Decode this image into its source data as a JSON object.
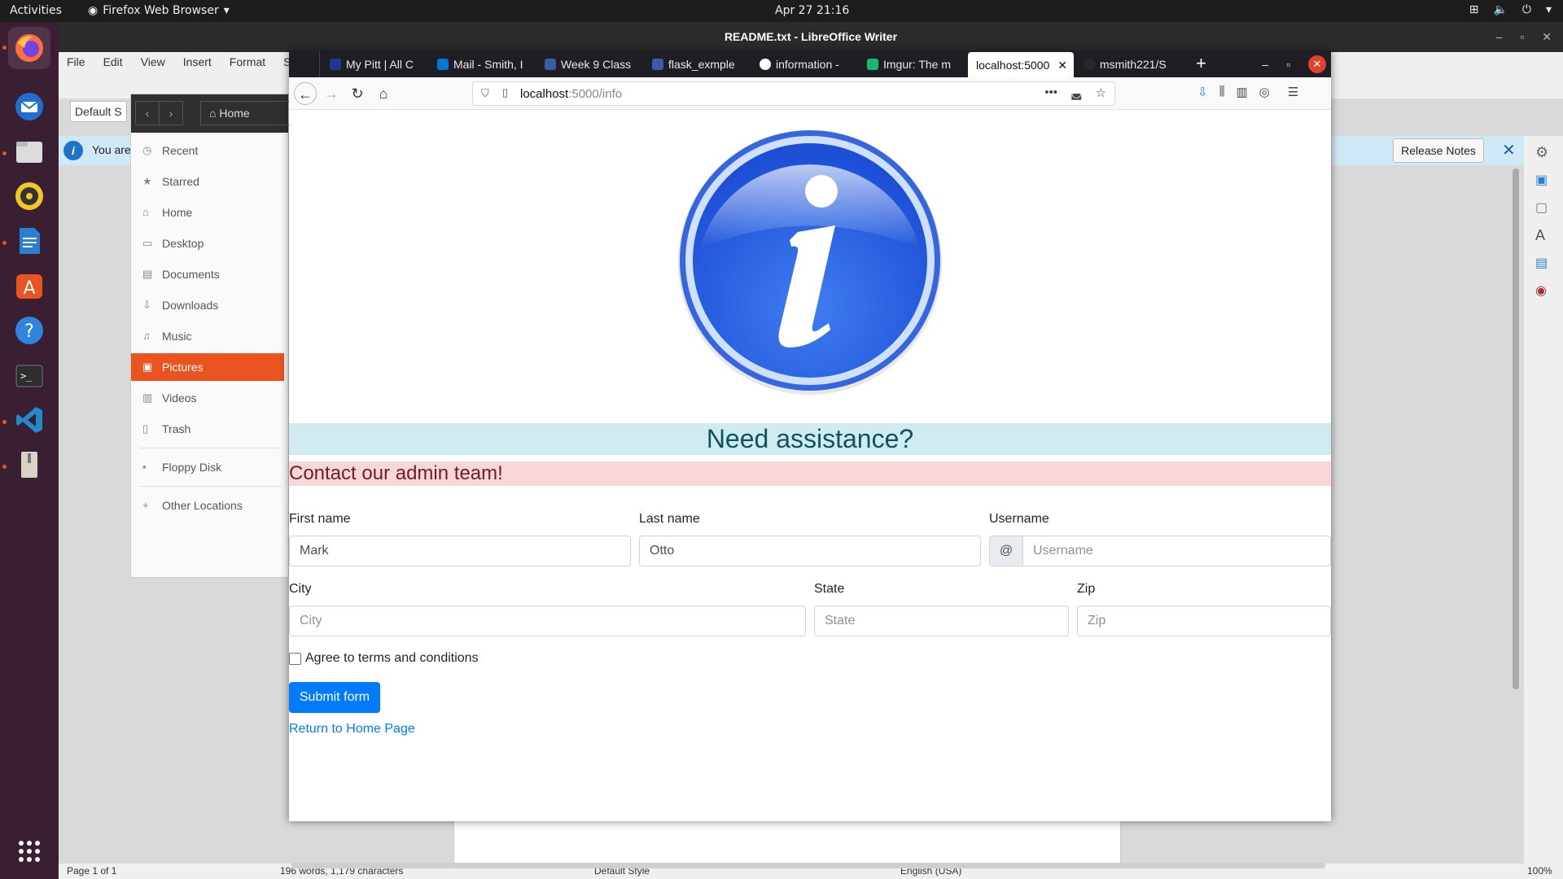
{
  "topbar": {
    "activities": "Activities",
    "app_name": "Firefox Web Browser",
    "clock": "Apr 27  21:16"
  },
  "writer": {
    "title": "README.txt - LibreOffice Writer",
    "menu": [
      "File",
      "Edit",
      "View",
      "Insert",
      "Format",
      "Sty"
    ],
    "para_style": "Default S",
    "info_msg": "You are",
    "release_notes": "Release Notes",
    "status": {
      "page": "Page 1 of 1",
      "words": "196 words, 1,179 characters",
      "style": "Default Style",
      "lang": "English (USA)",
      "zoom": "100%"
    }
  },
  "files": {
    "breadcrumb": "Home",
    "sidebar": [
      {
        "label": "Recent",
        "icon": "clock-icon"
      },
      {
        "label": "Starred",
        "icon": "star-icon"
      },
      {
        "label": "Home",
        "icon": "home-icon"
      },
      {
        "label": "Desktop",
        "icon": "desktop-icon"
      },
      {
        "label": "Documents",
        "icon": "document-icon"
      },
      {
        "label": "Downloads",
        "icon": "download-icon"
      },
      {
        "label": "Music",
        "icon": "music-icon"
      },
      {
        "label": "Pictures",
        "icon": "picture-icon",
        "active": true
      },
      {
        "label": "Videos",
        "icon": "video-icon"
      },
      {
        "label": "Trash",
        "icon": "trash-icon"
      },
      {
        "label": "Floppy Disk",
        "icon": "floppy-icon"
      },
      {
        "label": "Other Locations",
        "icon": "plus-icon"
      }
    ]
  },
  "browser": {
    "tabs": [
      {
        "label": "My Pitt | All C",
        "color": "#1a3a8f"
      },
      {
        "label": "Mail - Smith, I",
        "color": "#0078d4"
      },
      {
        "label": "Week 9 Class",
        "color": "#3b5ba5"
      },
      {
        "label": "flask_exmple",
        "color": "#3b5ba5"
      },
      {
        "label": "information -",
        "color": "#ffffff"
      },
      {
        "label": "Imgur: The m",
        "color": "#1bb76e"
      },
      {
        "label": "localhost:5000",
        "color": "",
        "active": true
      },
      {
        "label": "msmith221/S",
        "color": "#24292e"
      }
    ],
    "url_host": "localhost",
    "url_path": ":5000/info"
  },
  "page": {
    "heading": "Need assistance?",
    "subheading": "Contact our admin team!",
    "form": {
      "first_name_label": "First name",
      "first_name_value": "Mark",
      "last_name_label": "Last name",
      "last_name_value": "Otto",
      "username_label": "Username",
      "username_prefix": "@",
      "username_placeholder": "Username",
      "city_label": "City",
      "city_placeholder": "City",
      "state_label": "State",
      "state_placeholder": "State",
      "zip_label": "Zip",
      "zip_placeholder": "Zip",
      "agree_label": "Agree to terms and conditions",
      "submit_label": "Submit form"
    },
    "return_link": "Return to Home Page"
  },
  "colors": {
    "ubuntu_orange": "#e95420",
    "info_alert_bg": "#d1ecf1",
    "danger_alert_bg": "#f8d7da",
    "primary": "#007bff"
  }
}
